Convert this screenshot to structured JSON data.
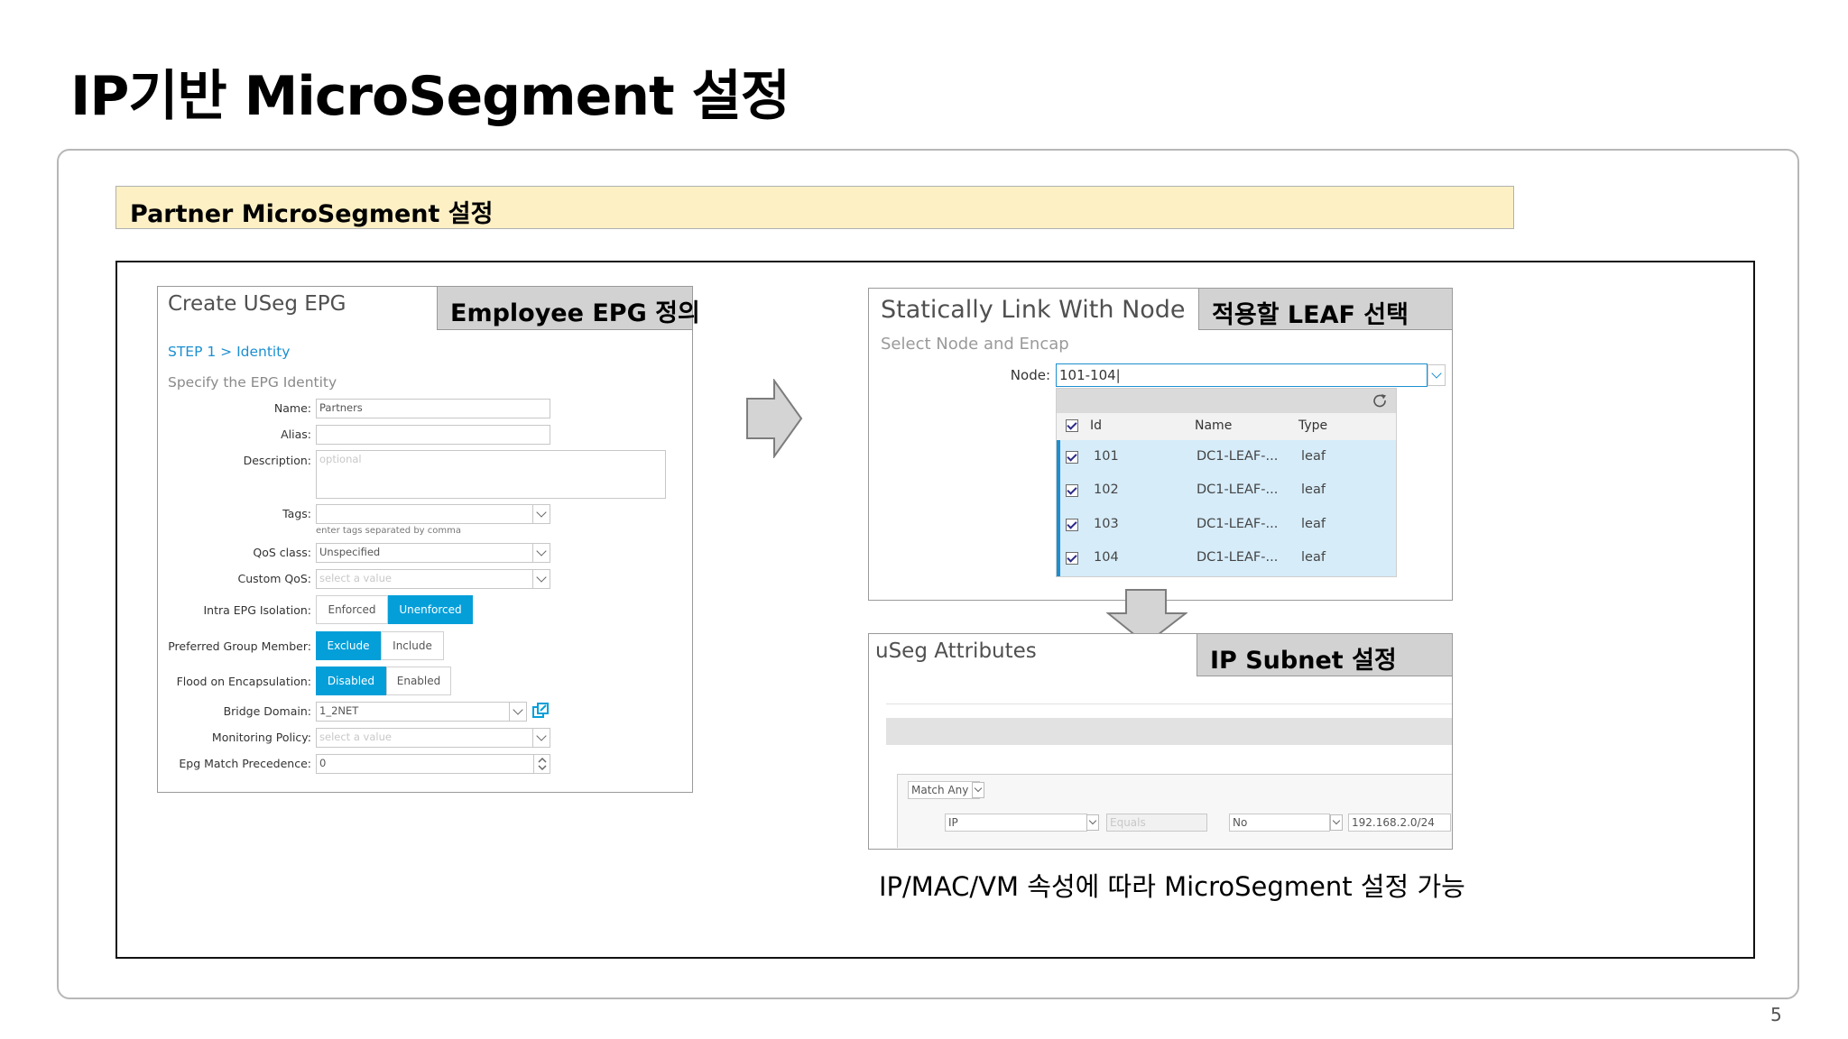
{
  "slide": {
    "title": "IP기반 MicroSegment 설정",
    "banner": "Partner MicroSegment 설정",
    "caption": "IP/MAC/VM 속성에 따라 MicroSegment 설정 가능",
    "page_number": "5"
  },
  "create_useg": {
    "title": "Create USeg EPG",
    "callout": "Employee EPG 정의",
    "step": "STEP 1 > Identity",
    "subtitle": "Specify the EPG Identity",
    "fields": {
      "name_label": "Name:",
      "name_value": "Partners",
      "alias_label": "Alias:",
      "description_label": "Description:",
      "description_placeholder": "optional",
      "tags_label": "Tags:",
      "tags_hint": "enter tags separated by comma",
      "qos_label": "QoS class:",
      "qos_value": "Unspecified",
      "custom_qos_label": "Custom QoS:",
      "custom_qos_placeholder": "select a value",
      "isolation_label": "Intra EPG Isolation:",
      "isolation_enforced": "Enforced",
      "isolation_unenforced": "Unenforced",
      "pref_group_label": "Preferred Group Member:",
      "pref_exclude": "Exclude",
      "pref_include": "Include",
      "flood_label": "Flood on Encapsulation:",
      "flood_disabled": "Disabled",
      "flood_enabled": "Enabled",
      "bd_label": "Bridge Domain:",
      "bd_value": "1_2NET",
      "monitoring_label": "Monitoring Policy:",
      "monitoring_placeholder": "select a value",
      "precedence_label": "Epg Match Precedence:",
      "precedence_value": "0"
    }
  },
  "static_link": {
    "title": "Statically Link With Node",
    "callout": "적용할 LEAF 선택",
    "subtitle": "Select Node and Encap",
    "node_label": "Node:",
    "node_value": "101-104|",
    "columns": [
      "Id",
      "Name",
      "Type"
    ],
    "rows": [
      {
        "id": "101",
        "name": "DC1-LEAF-...",
        "type": "leaf"
      },
      {
        "id": "102",
        "name": "DC1-LEAF-...",
        "type": "leaf"
      },
      {
        "id": "103",
        "name": "DC1-LEAF-...",
        "type": "leaf"
      },
      {
        "id": "104",
        "name": "DC1-LEAF-...",
        "type": "leaf"
      }
    ]
  },
  "useg_attr": {
    "title": "uSeg Attributes",
    "callout": "IP Subnet 설정",
    "match": "Match Any",
    "attr_type": "IP",
    "operator_placeholder": "Equals",
    "negate": "No",
    "value": "192.168.2.0/24"
  },
  "colors": {
    "accent_blue": "#049fd9",
    "selected_row_bg": "#d6ecf9",
    "banner_bg": "#fdf0c5",
    "callout_bg": "#d2d2d2"
  },
  "icons": [
    "arrow-right-icon",
    "arrow-down-icon",
    "chevron-down-icon",
    "refresh-icon",
    "external-link-icon",
    "checkbox-checked-icon",
    "stepper-icon"
  ]
}
